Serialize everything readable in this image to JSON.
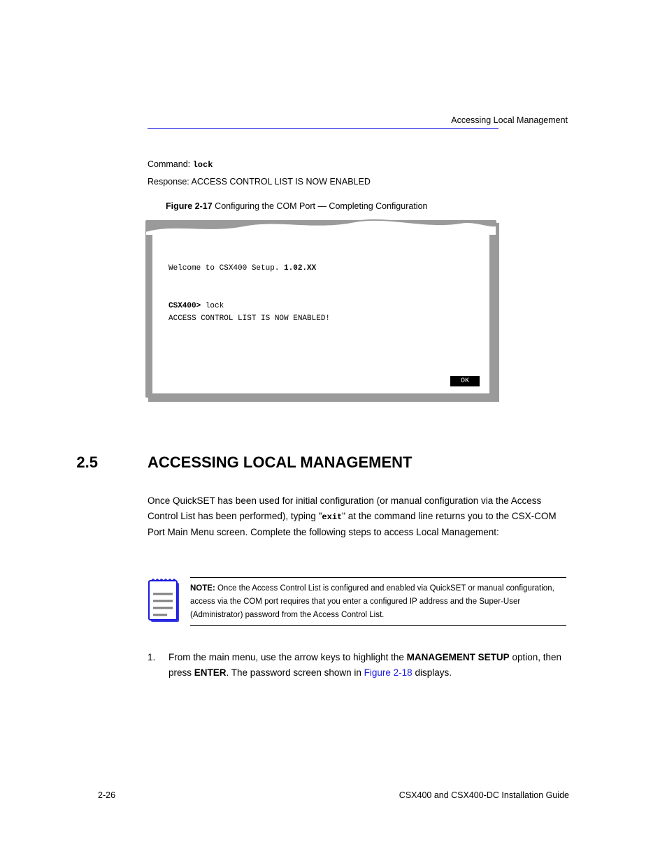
{
  "header": {
    "pagenum_left": "2-26",
    "right_small": "Accessing Local Management"
  },
  "pre_figure": {
    "cmd_label": "Command: ",
    "cmd_val": "lock",
    "resp_label": "Response: ",
    "resp_val": "ACCESS CONTROL LIST IS NOW ENABLED",
    "fig_bold": "Figure 2-17",
    "fig_rest": "  Configuring the COM Port — Completing Configuration"
  },
  "screen": {
    "line1_plain": "Welcome to CSX400 Setup. ",
    "line1_bold": "1.02.XX",
    "line4_bold": "CSX400>",
    "line4_plain": " lock",
    "line5": "ACCESS CONTROL LIST IS NOW ENABLED!",
    "ok": "OK"
  },
  "section": {
    "num": "2.5",
    "title": "ACCESSING LOCAL MANAGEMENT"
  },
  "body": {
    "p1_a": "Once QuickSET has been used for initial configuration (or manual configuration via the Access Control List has been performed), typing \"",
    "p1_mono": "exit",
    "p1_b": "\" at the command line returns you to the CSX-COM Port Main Menu screen.  Complete the following steps to access Local Management:"
  },
  "note": {
    "label": "NOTE: ",
    "text": "Once the Access Control List is configured and enabled via QuickSET or manual configuration, access via the COM port requires that you enter a configured IP address and the Super-User (Administrator) password from the Access Control List."
  },
  "list": {
    "num": "1.",
    "text_a": "From the main menu, use the arrow keys to highlight the ",
    "text_b": "MANAGEMENT SETUP",
    "text_c": " option, then press ",
    "text_d": "ENTER",
    "text_e": ". The password screen shown in ",
    "text_f": "Figure 2-18",
    "text_g": " displays."
  },
  "footer": {
    "left": "2-26",
    "right": "CSX400 and CSX400-DC Installation Guide"
  }
}
